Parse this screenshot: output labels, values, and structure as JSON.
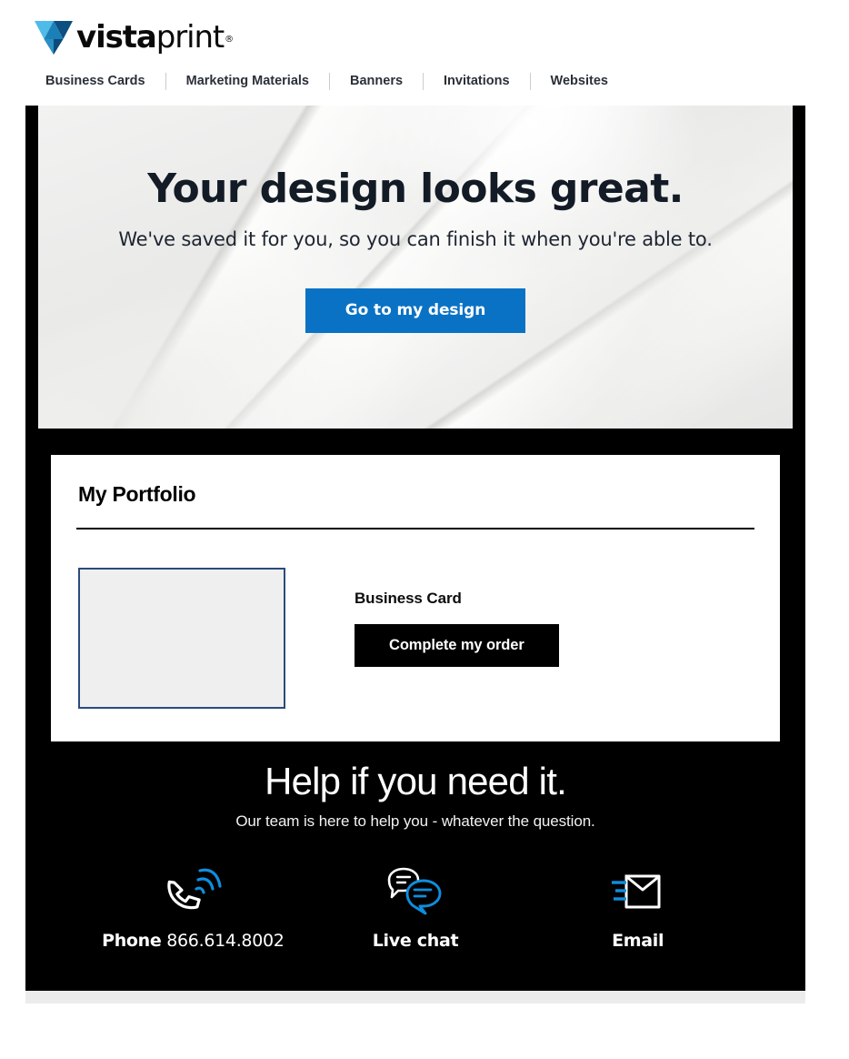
{
  "brand": {
    "logo_word_bold": "vista",
    "logo_word_light": "print",
    "logo_registered": "®",
    "logo_icon": "vistaprint-v-logo",
    "colors": {
      "logo_light_blue": "#4fbbe8",
      "logo_mid_blue": "#1b7fb8",
      "logo_dark_blue": "#0d4f80",
      "cta_blue": "#0a72c4",
      "accent_blue": "#0e8ede",
      "black": "#000000",
      "thumb_border": "#2c4a7c",
      "thumb_fill": "#efefef"
    }
  },
  "nav": {
    "items": [
      {
        "label": "Business Cards"
      },
      {
        "label": "Marketing Materials"
      },
      {
        "label": "Banners"
      },
      {
        "label": "Invitations"
      },
      {
        "label": "Websites"
      }
    ]
  },
  "hero": {
    "title": "Your design looks great.",
    "subtitle": "We've saved it for you, so you can finish it when you're able to.",
    "cta_label": "Go to my design"
  },
  "portfolio": {
    "title": "My Portfolio",
    "items": [
      {
        "name": "Business Card",
        "cta_label": "Complete my order",
        "thumbnail": "empty-design-preview"
      }
    ]
  },
  "help": {
    "title": "Help if you need it.",
    "subtitle": "Our team is here to help you - whatever the question.",
    "contacts": [
      {
        "icon": "phone-ringing-icon",
        "label_bold": "Phone",
        "label_value": " 866.614.8002"
      },
      {
        "icon": "chat-bubbles-icon",
        "label_bold": "Live chat",
        "label_value": ""
      },
      {
        "icon": "envelope-icon",
        "label_bold": "Email",
        "label_value": ""
      }
    ]
  }
}
